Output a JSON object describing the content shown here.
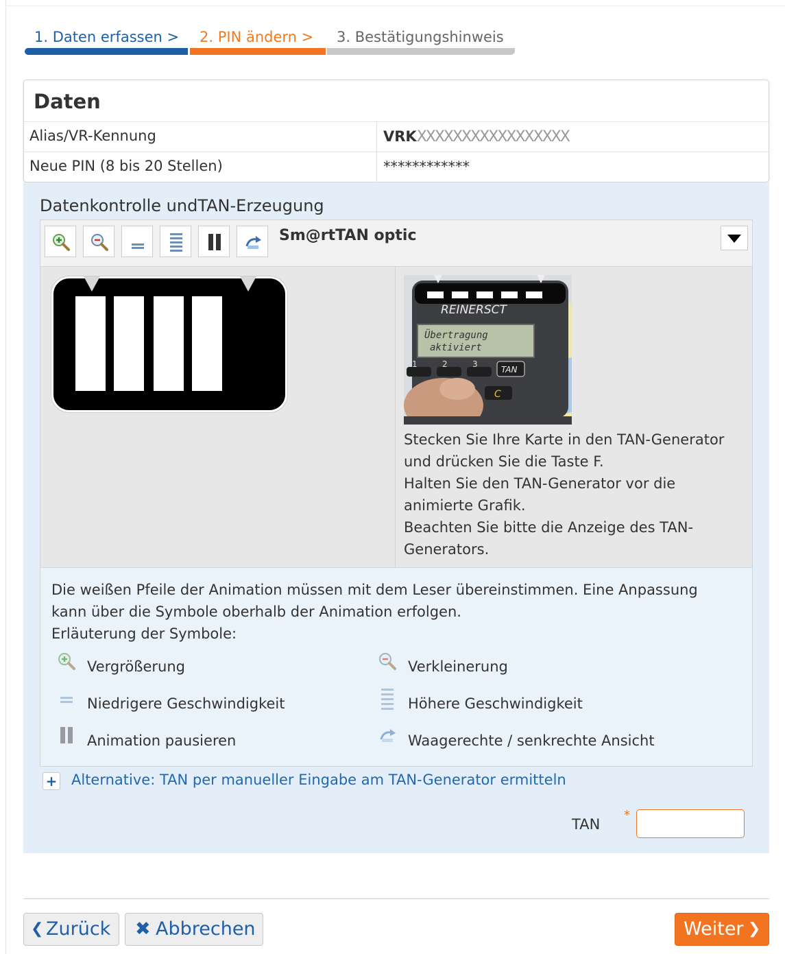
{
  "steps": [
    {
      "label": "1. Daten erfassen  >",
      "state": "done"
    },
    {
      "label": "2. PIN ändern  >",
      "state": "active"
    },
    {
      "label": "3. Bestätigungshinweis",
      "state": "pending"
    }
  ],
  "daten": {
    "title": "Daten",
    "rows": [
      {
        "label": "Alias/VR-Kennung",
        "value_prefix": "VRK",
        "value_masked": "XXXXXXXXXXXXXXXXX"
      },
      {
        "label": "Neue PIN (8 bis 20 Stellen)",
        "value": "************"
      }
    ]
  },
  "tan": {
    "title": "Datenkontrolle undTAN-Erzeugung",
    "toolbar": {
      "buttons": [
        "zoom-in-icon",
        "zoom-out-icon",
        "slower-icon",
        "faster-icon",
        "pause-icon",
        "rotate-icon"
      ],
      "verfahren": "Sm@rtTAN optic"
    },
    "device": {
      "brand": "REINERSCT",
      "screen_line1": "Übertragung",
      "screen_line2": "aktiviert",
      "key_tan": "TAN",
      "key_c": "C",
      "key_1": "1",
      "key_2": "2",
      "key_3": "3"
    },
    "instructions": [
      "Stecken Sie Ihre Karte in den TAN-Generator und drücken Sie die Taste F.",
      "Halten Sie den TAN-Generator vor die animierte Grafik.",
      "Beachten Sie bitte die Anzeige des TAN-Generators."
    ],
    "legend_intro": "Die weißen Pfeile der Animation müssen mit dem Leser übereinstimmen. Eine Anpassung kann über die Symbole oberhalb der Animation erfolgen.",
    "legend_heading": "Erläuterung der Symbole:",
    "legend": [
      {
        "icon": "zoom-in-icon",
        "label": "Vergrößerung"
      },
      {
        "icon": "zoom-out-icon",
        "label": "Verkleinerung"
      },
      {
        "icon": "slower-icon",
        "label": "Niedrigere Geschwindigkeit"
      },
      {
        "icon": "faster-icon",
        "label": "Höhere Geschwindigkeit"
      },
      {
        "icon": "pause-icon",
        "label": "Animation pausieren"
      },
      {
        "icon": "rotate-icon",
        "label": "Waagerechte / senkrechte Ansicht"
      }
    ],
    "alternative_link": "Alternative: TAN per manueller Eingabe am TAN-Generator ermitteln",
    "tan_label": "TAN",
    "required_mark": "*",
    "tan_value": ""
  },
  "buttons": {
    "back": "Zurück",
    "cancel": "Abbrechen",
    "next": "Weiter"
  },
  "colors": {
    "blue": "#1d5da3",
    "orange": "#f27421",
    "grey_step": "#c7c7c7",
    "panel_bg": "#e3eef8"
  }
}
